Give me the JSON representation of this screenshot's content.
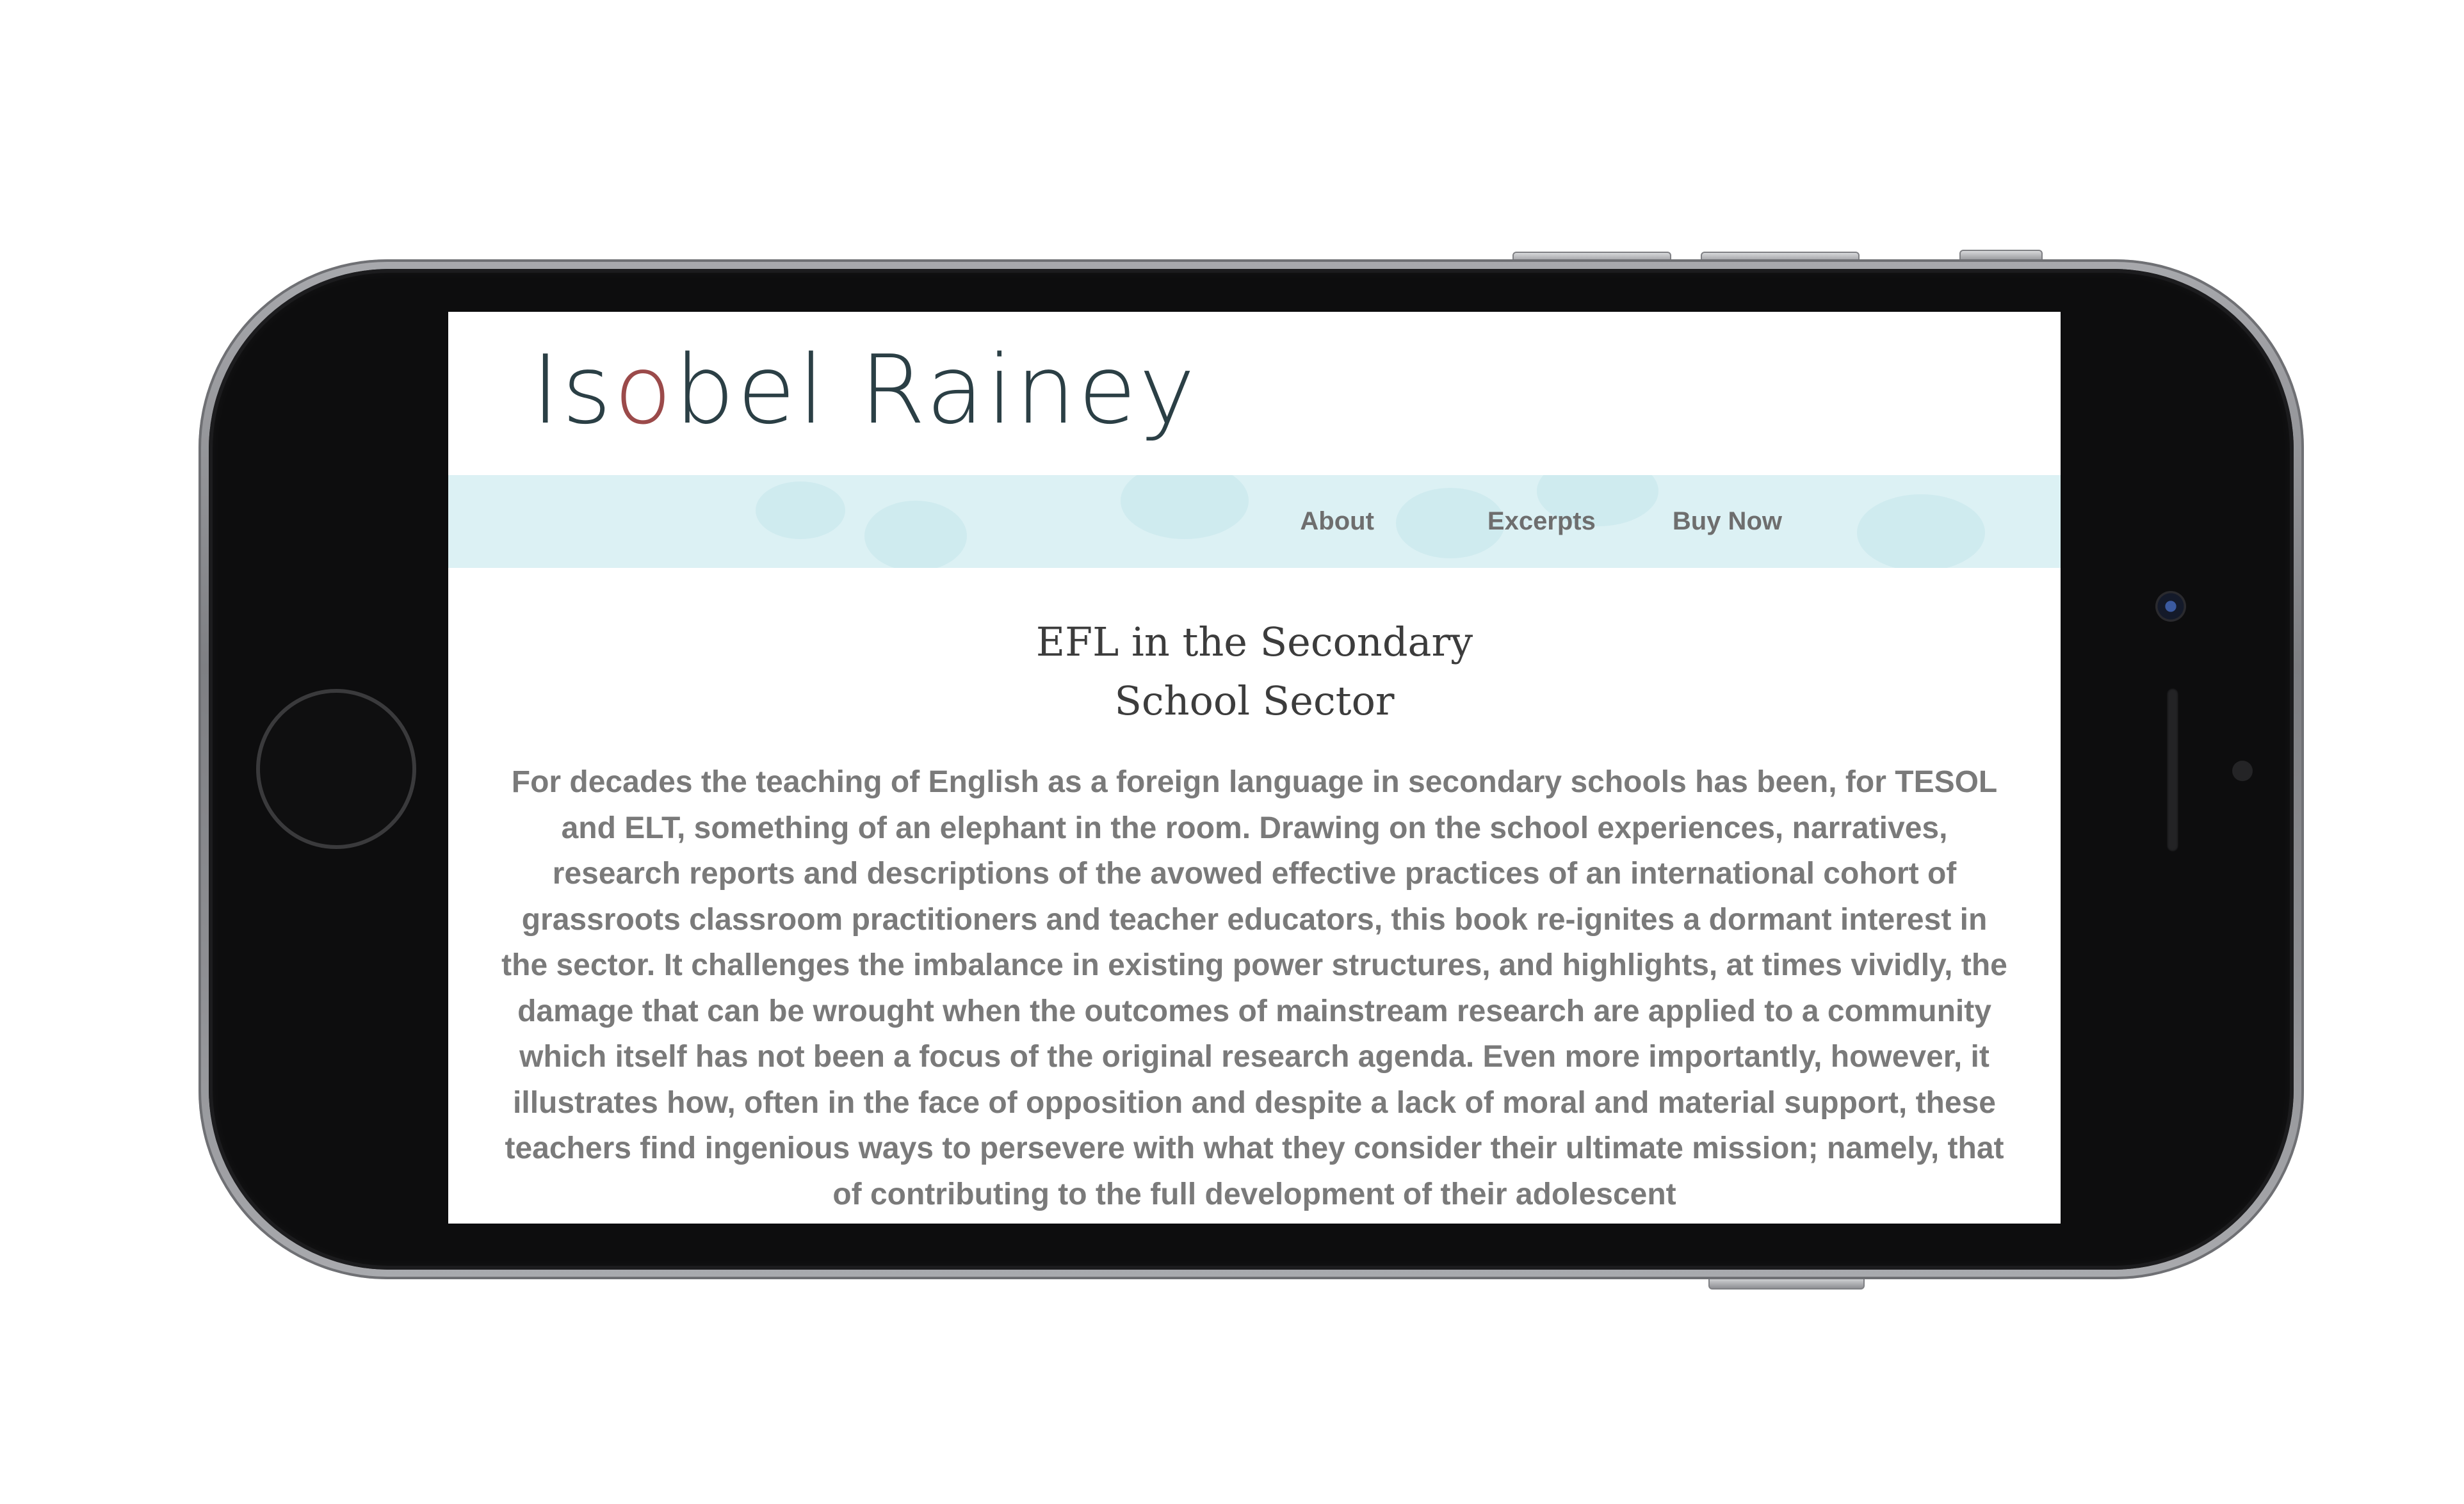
{
  "site": {
    "logo_part1": "Is",
    "logo_accent": "o",
    "logo_part2": "bel Rainey"
  },
  "nav": {
    "items": [
      {
        "label": "About"
      },
      {
        "label": "Excerpts"
      },
      {
        "label": "Buy Now"
      }
    ]
  },
  "main": {
    "title_line1": "EFL in the Secondary",
    "title_line2": "School Sector",
    "description": "For decades the teaching of English as a foreign language in secondary schools has been, for TESOL and ELT, something of an elephant in the room. Drawing on the school experiences, narratives, research reports and descriptions of the avowed effective practices of an international cohort of grassroots classroom practitioners and teacher educators, this book re-ignites a dormant interest in the sector. It challenges the imbalance in existing power structures, and highlights, at times vividly, the damage that can be wrought when the outcomes of mainstream research are applied to a community which itself has not been a focus of the original research agenda. Even more importantly, however, it illustrates how, often in the face of opposition and despite a lack of moral and material support, these teachers find ingenious ways to persevere with what they consider their ultimate mission; namely, that of contributing to the full development of their adolescent"
  },
  "colors": {
    "nav_background": "#dcf1f4",
    "logo_text": "#2b3f45",
    "logo_accent": "#9b4a4a",
    "body_text": "#7a7a7a",
    "title_text": "#3c3c3c"
  },
  "icons": {
    "home_button": "home-button-icon",
    "camera": "front-camera-icon"
  }
}
